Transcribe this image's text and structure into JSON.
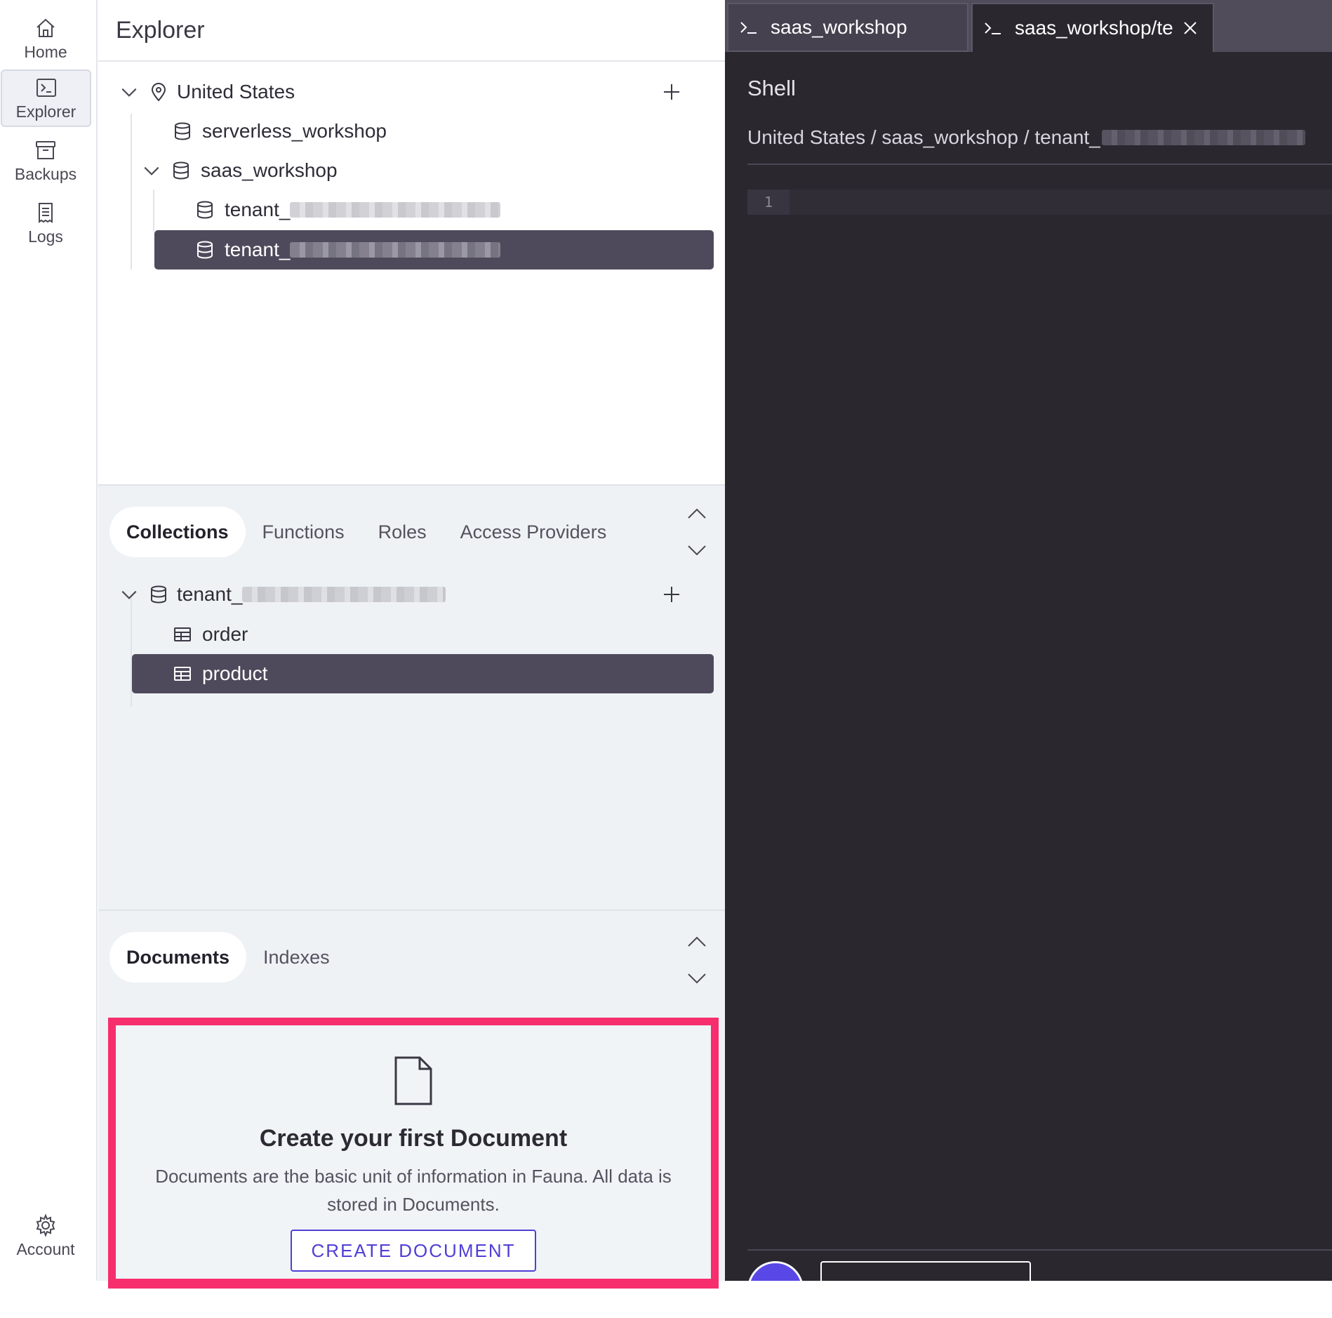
{
  "nav": {
    "home": "Home",
    "explorer": "Explorer",
    "backups": "Backups",
    "logs": "Logs",
    "account": "Account"
  },
  "explorer": {
    "title": "Explorer",
    "tree": {
      "region": "United States",
      "db1": "serverless_workshop",
      "db2": "saas_workshop",
      "tenant1": "tenant_",
      "tenant2": "tenant_"
    }
  },
  "collections_panel": {
    "tabs": [
      "Collections",
      "Functions",
      "Roles",
      "Access Providers"
    ],
    "active_tab": "Collections",
    "tenant": "tenant_",
    "items": [
      "order",
      "product"
    ],
    "selected": "product"
  },
  "documents_panel": {
    "tabs": [
      "Documents",
      "Indexes"
    ],
    "active_tab": "Documents",
    "empty_title": "Create your first Document",
    "empty_desc": "Documents are the basic unit of information in Fauna. All data is stored in Documents.",
    "create_button": "CREATE DOCUMENT"
  },
  "shell": {
    "tabs": [
      {
        "label": "saas_workshop"
      },
      {
        "label": "saas_workshop/te"
      }
    ],
    "title": "Shell",
    "breadcrumb": "United States / saas_workshop / tenant_",
    "line_number": "1"
  },
  "colors": {
    "accent": "#4f3ed6",
    "highlight_border": "#f72e6d",
    "selected_row": "#4e4a5b",
    "shell_bg": "#2a272f"
  }
}
